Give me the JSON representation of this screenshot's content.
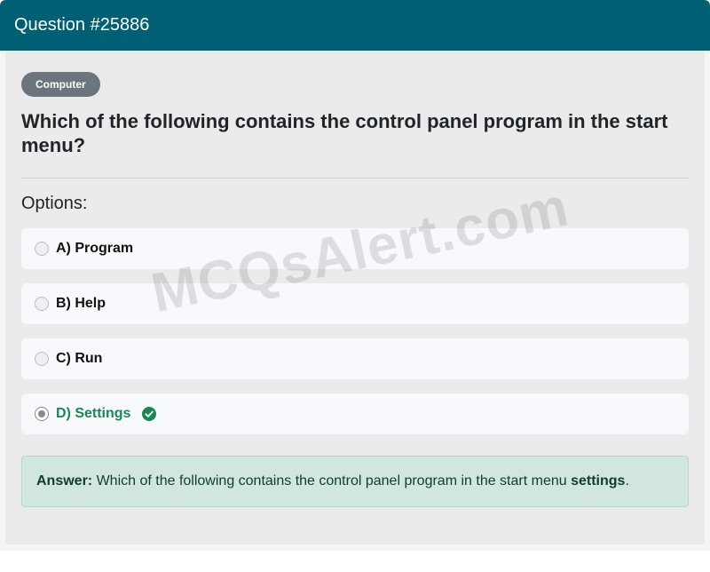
{
  "header": {
    "title": "Question #25886"
  },
  "category": {
    "label": "Computer"
  },
  "question": {
    "text": "Which of the following contains the control panel program in the start menu?"
  },
  "options_title": "Options:",
  "options": [
    {
      "label": "A) Program",
      "selected": false,
      "correct": false
    },
    {
      "label": "B) Help",
      "selected": false,
      "correct": false
    },
    {
      "label": "C) Run",
      "selected": false,
      "correct": false
    },
    {
      "label": "D) Settings",
      "selected": true,
      "correct": true
    }
  ],
  "answer": {
    "prefix": "Answer:",
    "text": "Which of the following contains the control panel program in the start menu",
    "highlight": "settings",
    "suffix": "."
  },
  "watermark": "MCQsAlert.com",
  "colors": {
    "header": "#005f73",
    "badge": "#6c757d",
    "correct": "#198754",
    "answer_bg": "#d1e7dd"
  },
  "icons": {
    "correct": "check-circle-icon"
  }
}
